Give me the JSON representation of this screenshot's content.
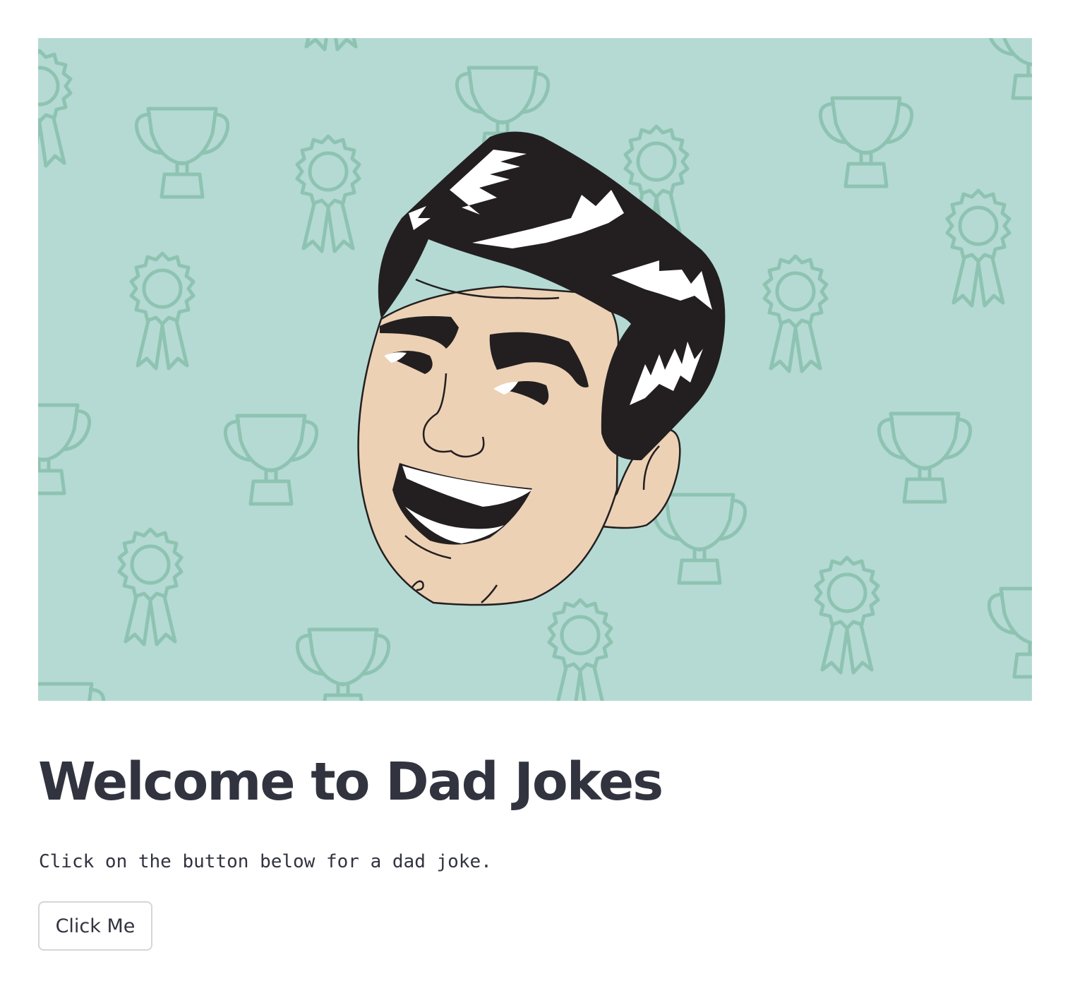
{
  "hero": {
    "image_alt": "Cartoon dad face laughing on a trophy and ribbon pattern",
    "background_color": "#b4dad3",
    "pattern_color": "#8ec3b2",
    "pattern_icons": [
      "trophy-icon",
      "ribbon-icon"
    ]
  },
  "main": {
    "title": "Welcome to Dad Jokes",
    "description": "Click on the button below for a dad joke.",
    "button_label": "Click Me"
  },
  "colors": {
    "text": "#31333f",
    "button_border": "#d6d6d9"
  }
}
